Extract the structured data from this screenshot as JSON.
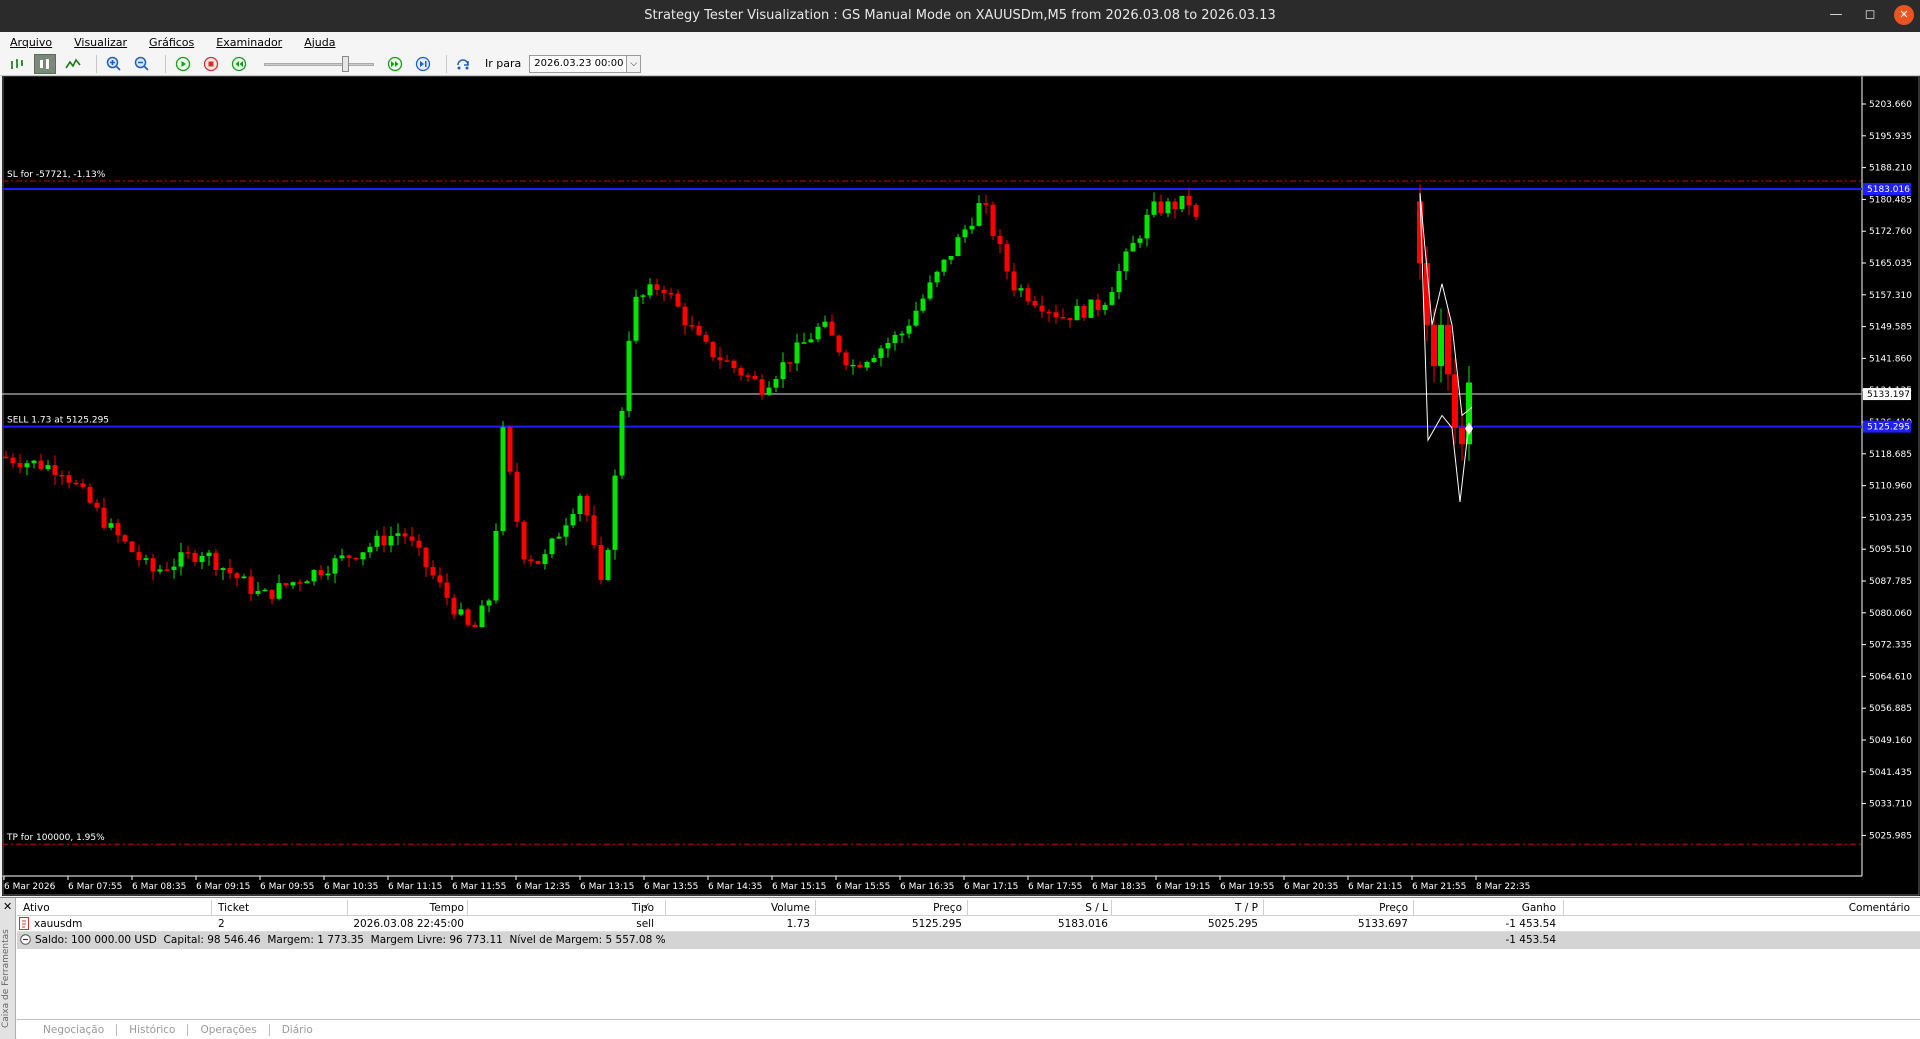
{
  "window": {
    "title": "Strategy Tester Visualization : GS Manual Mode on XAUUSDm,M5 from 2026.03.08 to 2026.03.13"
  },
  "menu": [
    "Arquivo",
    "Visualizar",
    "Gráficos",
    "Examinador",
    "Ajuda"
  ],
  "toolbar": {
    "goto_label": "Ir para",
    "goto_date": "2026.03.23 00:00"
  },
  "chart": {
    "y_ticks": [
      "5203.660",
      "5195.935",
      "5188.210",
      "5180.485",
      "5172.760",
      "5165.035",
      "5157.310",
      "5149.585",
      "5141.860",
      "5134.135",
      "5126.410",
      "5118.685",
      "5110.960",
      "5103.235",
      "5095.510",
      "5087.785",
      "5080.060",
      "5072.335",
      "5064.610",
      "5056.885",
      "5049.160",
      "5041.435",
      "5033.710",
      "5025.985"
    ],
    "x_ticks": [
      "6 Mar 2026",
      "6 Mar 07:55",
      "6 Mar 08:35",
      "6 Mar 09:15",
      "6 Mar 09:55",
      "6 Mar 10:35",
      "6 Mar 11:15",
      "6 Mar 11:55",
      "6 Mar 12:35",
      "6 Mar 13:15",
      "6 Mar 13:55",
      "6 Mar 14:35",
      "6 Mar 15:15",
      "6 Mar 15:55",
      "6 Mar 16:35",
      "6 Mar 17:15",
      "6 Mar 17:55",
      "6 Mar 18:35",
      "6 Mar 19:15",
      "6 Mar 19:55",
      "6 Mar 20:35",
      "6 Mar 21:15",
      "6 Mar 21:55",
      "8 Mar 22:35"
    ],
    "sl_label": "SL for -57721, -1.13%",
    "sell_label": "SELL 1.73 at 5125.295",
    "tp_label": "TP for 100000, 1.95%",
    "current_price": "5133.197",
    "sl_price_tag": "5183.016",
    "entry_price_tag": "5125.295",
    "sl_price": 5183.016,
    "entry_price": 5125.295,
    "tp_price": 5025.295,
    "price_line": 5133.197,
    "colors": {
      "bull": "#00e600",
      "bear": "#ff0000",
      "sl_tp": "#cc0000",
      "order_line": "#1e1eff",
      "axis": "#ffffff"
    }
  },
  "trades_table": {
    "headers": [
      "Ativo",
      "Ticket",
      "Tempo",
      "Tipo",
      "Volume",
      "Preço",
      "S / L",
      "T / P",
      "Preço",
      "Ganho",
      "Comentário"
    ],
    "rows": [
      [
        "xauusdm",
        "2",
        "2026.03.08 22:45:00",
        "sell",
        "1.73",
        "5125.295",
        "5183.016",
        "5025.295",
        "5133.697",
        "-1 453.54",
        ""
      ]
    ],
    "summary": "Saldo: 100 000.00 USD  Capital: 98 546.46  Margem: 1 773.35  Margem Livre: 96 773.11  Nível de Margem: 5 557.08 %",
    "summary_profit": "-1 453.54"
  },
  "toolbox": {
    "side_label": "Caixa de Ferramentas",
    "tabs": [
      "Negociação",
      "Histórico",
      "Operações",
      "Diário"
    ]
  }
}
